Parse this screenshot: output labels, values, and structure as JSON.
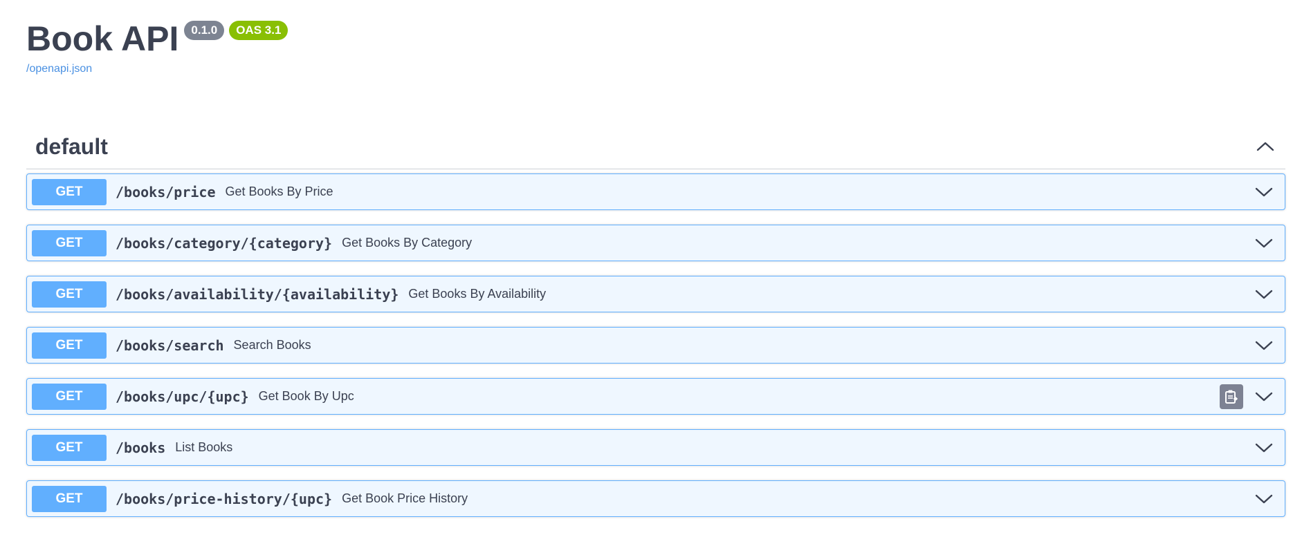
{
  "info": {
    "title": "Book API",
    "version_badge": "0.1.0",
    "oas_badge": "OAS 3.1",
    "spec_link": "/openapi.json"
  },
  "colors": {
    "version_badge_bg": "#7d8492",
    "oas_badge_bg": "#89bf04",
    "link": "#4990e2",
    "get_method_bg": "#61affe",
    "get_border": "#61affe",
    "copy_button_bg": "#7d8293"
  },
  "tag": {
    "name": "default",
    "toggle_icon": "chevron-up-icon"
  },
  "operations": [
    {
      "method": "GET",
      "path": "/books/price",
      "summary": "Get Books By Price",
      "show_copy": false
    },
    {
      "method": "GET",
      "path": "/books/category/{category}",
      "summary": "Get Books By Category",
      "show_copy": false
    },
    {
      "method": "GET",
      "path": "/books/availability/{availability}",
      "summary": "Get Books By Availability",
      "show_copy": false
    },
    {
      "method": "GET",
      "path": "/books/search",
      "summary": "Search Books",
      "show_copy": false
    },
    {
      "method": "GET",
      "path": "/books/upc/{upc}",
      "summary": "Get Book By Upc",
      "show_copy": true
    },
    {
      "method": "GET",
      "path": "/books",
      "summary": "List Books",
      "show_copy": false
    },
    {
      "method": "GET",
      "path": "/books/price-history/{upc}",
      "summary": "Get Book Price History",
      "show_copy": false
    }
  ]
}
